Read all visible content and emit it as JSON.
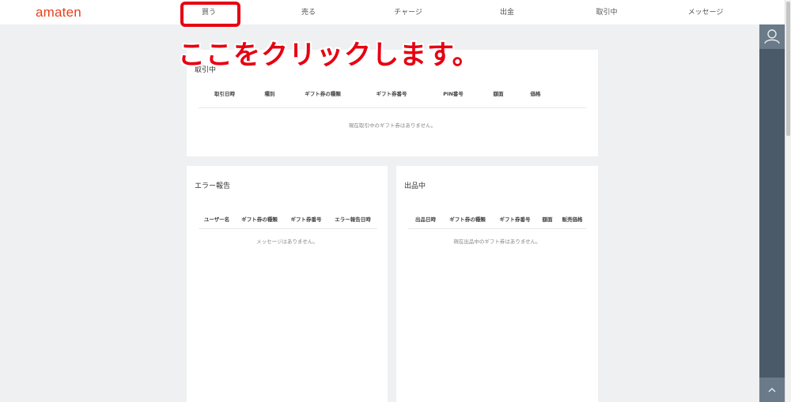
{
  "header": {
    "logo": "amaten",
    "nav": [
      "買う",
      "売る",
      "チャージ",
      "出金",
      "取引中",
      "メッセージ"
    ]
  },
  "annotation": "ここをクリックします。",
  "transactions": {
    "title": "取引中",
    "columns": [
      "取引日時",
      "種別",
      "ギフト券の種類",
      "ギフト券番号",
      "PIN番号",
      "額面",
      "価格"
    ],
    "empty": "現在取引中のギフト券はありません。"
  },
  "errors": {
    "title": "エラー報告",
    "columns": [
      "ユーザー名",
      "ギフト券の種類",
      "ギフト券番号",
      "エラー報告日時"
    ],
    "empty": "メッセージはありません。"
  },
  "listings": {
    "title": "出品中",
    "columns": [
      "出品日時",
      "ギフト券の種類",
      "ギフト券番号",
      "額面",
      "販売価格"
    ],
    "empty": "現在出品中のギフト券はありません。"
  },
  "icons": {
    "rail_top": "user-icon",
    "rail_bottom": "chevron-up-icon"
  }
}
